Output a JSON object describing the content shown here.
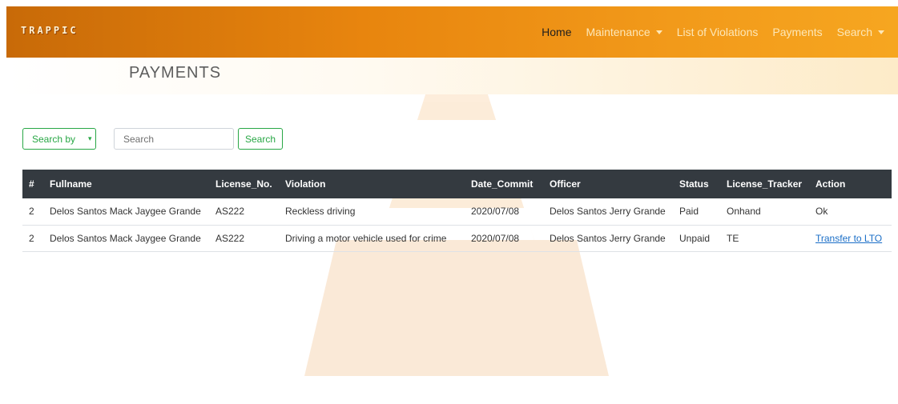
{
  "app": {
    "brand": "TRAPPIC"
  },
  "nav": {
    "items": [
      {
        "label": "Home",
        "active": true,
        "dropdown": false
      },
      {
        "label": "Maintenance",
        "active": false,
        "dropdown": true
      },
      {
        "label": "List of Violations",
        "active": false,
        "dropdown": false
      },
      {
        "label": "Payments",
        "active": false,
        "dropdown": false
      },
      {
        "label": "Search",
        "active": false,
        "dropdown": true
      }
    ]
  },
  "page": {
    "title": "PAYMENTS"
  },
  "search": {
    "select_label": "Search by",
    "input_placeholder": "Search",
    "button_label": "Search"
  },
  "table": {
    "headers": [
      "#",
      "Fullname",
      "License_No.",
      "Violation",
      "Date_Commit",
      "Officer",
      "Status",
      "License_Tracker",
      "Action"
    ],
    "rows": [
      [
        "2",
        "Delos Santos Mack Jaygee Grande",
        "AS222",
        "Reckless driving",
        "2020/07/08",
        "Delos Santos Jerry Grande",
        "Paid",
        "Onhand",
        "Ok"
      ],
      [
        "2",
        "Delos Santos Mack Jaygee Grande",
        "AS222",
        "Driving a motor vehicle used for crime",
        "2020/07/08",
        "Delos Santos Jerry Grande",
        "Unpaid",
        "TE",
        "Transfer to LTO"
      ]
    ]
  },
  "colors": {
    "accent": "#28a745",
    "nav_start": "#c86a08",
    "nav_end": "#f6a620",
    "table_header": "#343a40",
    "link": "#1a6ec7"
  }
}
